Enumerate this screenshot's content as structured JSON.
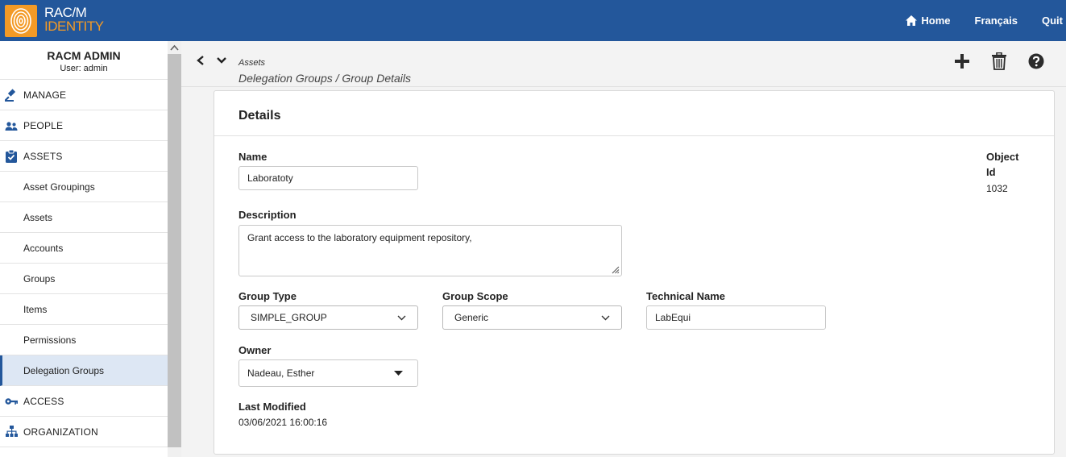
{
  "app": {
    "brand_line1": "RAC/M",
    "brand_line2": "IDENTITY",
    "colors": {
      "topbar": "#23579b",
      "accent": "#f39a26",
      "active_item_bg": "#dde7f4"
    }
  },
  "topnav": {
    "home": "Home",
    "language": "Français",
    "quit": "Quit"
  },
  "sidebar": {
    "admin_name": "RACM ADMIN",
    "user_line": "User: admin",
    "sections": {
      "manage": {
        "label": "MANAGE",
        "icon": "gavel-icon"
      },
      "people": {
        "label": "PEOPLE",
        "icon": "people-icon"
      },
      "assets": {
        "label": "ASSETS",
        "icon": "clipboard-check-icon"
      },
      "access": {
        "label": "ACCESS",
        "icon": "key-icon"
      },
      "organization": {
        "label": "ORGANIZATION",
        "icon": "sitemap-icon"
      }
    },
    "asset_items": [
      "Asset Groupings",
      "Assets",
      "Accounts",
      "Groups",
      "Items",
      "Permissions",
      "Delegation Groups"
    ],
    "active_item": "Delegation Groups"
  },
  "breadcrumb": {
    "section": "Assets",
    "path": "Delegation Groups / Group Details"
  },
  "toolbar": {
    "add_icon": "plus-icon",
    "delete_icon": "trash-icon",
    "help_icon": "question-circle-icon"
  },
  "details": {
    "title": "Details",
    "name_label": "Name",
    "name_value": "Laboratoty",
    "description_label": "Description",
    "description_value": "Grant access to the laboratory equipment repository,",
    "group_type_label": "Group Type",
    "group_type_value": "SIMPLE_GROUP",
    "group_scope_label": "Group Scope",
    "group_scope_value": "Generic",
    "technical_name_label": "Technical Name",
    "technical_name_value": "LabEqui",
    "owner_label": "Owner",
    "owner_value": "Nadeau, Esther",
    "last_modified_label": "Last Modified",
    "last_modified_value": "03/06/2021 16:00:16",
    "object_id_label_1": "Object",
    "object_id_label_2": "Id",
    "object_id_value": "1032"
  }
}
